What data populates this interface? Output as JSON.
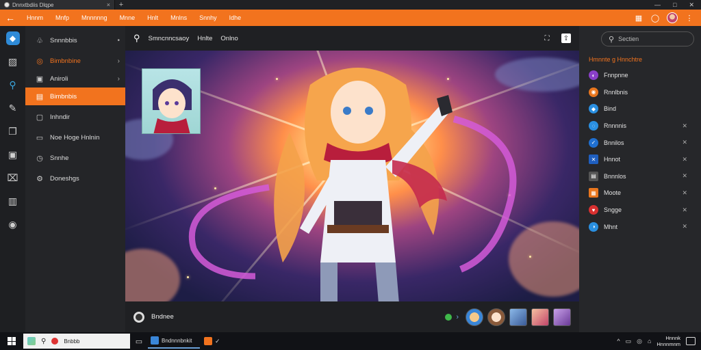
{
  "browser": {
    "tab_title": "Dnnxtbdiis Dlqpe",
    "tab_close": "×",
    "new_tab": "+",
    "controls": [
      "—",
      "□",
      "✕"
    ]
  },
  "menubar": {
    "back": "←",
    "items": [
      "Hnnm",
      "Mnfp",
      "Mnnnnng",
      "Mnne",
      "Hnlt",
      "Mnlns",
      "Snnhy",
      "Idhe"
    ],
    "accent": "#f2731e"
  },
  "rail": {
    "icons": [
      "brand-icon",
      "image-icon",
      "search-icon",
      "pen-icon",
      "layers-icon",
      "frame-icon",
      "gift-icon",
      "film-icon",
      "disc-icon"
    ]
  },
  "nav": {
    "items": [
      {
        "label": "Snnnbbis",
        "icon": "♧",
        "chevron": "•"
      },
      {
        "label": "Bimbnbine",
        "icon": "◎",
        "chevron": "›",
        "section": true
      },
      {
        "label": "Aniroli",
        "icon": "▣",
        "chevron": "›"
      },
      {
        "label": "Bimbnbis",
        "icon": "▤",
        "chevron": "",
        "selected": true
      },
      {
        "label": "Inhndir",
        "icon": "▢",
        "chevron": ""
      },
      {
        "label": "Noe Hoge Hnlnin",
        "icon": "▭",
        "chevron": ""
      },
      {
        "label": "Snnhe",
        "icon": "◷",
        "chevron": ""
      },
      {
        "label": "Doneshgs",
        "icon": "⚙",
        "chevron": ""
      }
    ]
  },
  "toolbar": {
    "items": [
      "Smncnncsaoy",
      "Hnlte",
      "Onlno"
    ],
    "right_icons": [
      "expand-icon",
      "share-icon"
    ]
  },
  "bottombar": {
    "label": "Bndnee"
  },
  "rpanel": {
    "search_placeholder": "Sectien",
    "title": "Hmnnte g Hnnchtre",
    "items": [
      {
        "label": "Fnnpnne",
        "color": "#8a3fc8",
        "glyph": "◐",
        "close": ""
      },
      {
        "label": "Rnnlbnis",
        "color": "#e8761e",
        "glyph": "◉",
        "close": ""
      },
      {
        "label": "Bind",
        "color": "#2a8fe0",
        "glyph": "◆",
        "close": ""
      },
      {
        "label": "Rnnnnis",
        "color": "#2a8fe0",
        "glyph": "◌",
        "close": "✕"
      },
      {
        "label": "Bnnilos",
        "color": "#1f6fd0",
        "glyph": "✓",
        "close": "✕"
      },
      {
        "label": "Hnnot",
        "color": "#1f5fc0",
        "glyph": "✕",
        "close": "✕",
        "square": true
      },
      {
        "label": "Bnnnlos",
        "color": "#555",
        "glyph": "▤",
        "close": "✕",
        "square": true
      },
      {
        "label": "Moote",
        "color": "#e8761e",
        "glyph": "▦",
        "close": "✕",
        "square": true
      },
      {
        "label": "Sngge",
        "color": "#d83030",
        "glyph": "♥",
        "close": "✕"
      },
      {
        "label": "Mhnt",
        "color": "#2a8fe0",
        "glyph": "◑",
        "close": "✕"
      }
    ]
  },
  "taskbar": {
    "search_text": "Bnbbb",
    "active_app": "Bndnnnbnkit",
    "tray_icons": [
      "^",
      "▭",
      "◎",
      "⌂"
    ],
    "clock_time": "Hnnnk",
    "clock_date": "Hnnnmnm"
  }
}
